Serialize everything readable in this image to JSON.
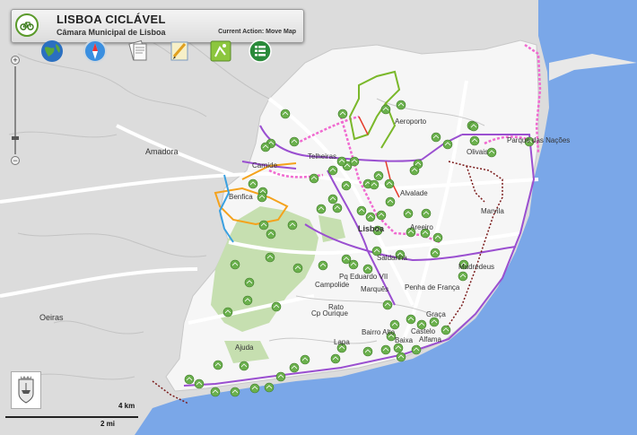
{
  "header": {
    "title": "LISBOA CICLÁVEL",
    "subtitle": "Câmara Municipal de Lisboa",
    "current_action": "Current Action: Move Map"
  },
  "toolbar": {
    "tools": [
      {
        "name": "globe-icon"
      },
      {
        "name": "compass-icon"
      },
      {
        "name": "document-icon"
      },
      {
        "name": "edit-icon"
      },
      {
        "name": "bike-route-icon"
      },
      {
        "name": "list-icon"
      }
    ]
  },
  "zoom": {
    "plus": "+",
    "minus": "−"
  },
  "scale": {
    "km": "4 km",
    "mi": "2 mi"
  },
  "labels": {
    "amadora": "Amadora",
    "oeiras": "Oeiras",
    "aeroporto": "Aeroporto",
    "lisboa": "Lisboa",
    "telheiras": "Telheiras",
    "carnide": "Carnide",
    "benfica": "Benfica",
    "alvalade": "Alvalade",
    "olivais": "Olivais",
    "parque_nacoes": "Parque das Nações",
    "marvila": "Marvila",
    "areeiro": "Areeiro",
    "saldanha": "Saldanha",
    "campolide": "Campolide",
    "pq_eduardo": "Pq Eduardo VII",
    "penha_franca": "Penha de França",
    "marques": "Marquês",
    "campo_ourique": "Cp Ourique",
    "rato": "Rato",
    "graca": "Graça",
    "bairro_alto": "Bairro Alto",
    "castelo": "Castelo",
    "alfama": "Alfama",
    "lapa": "Lapa",
    "ajuda": "Ajuda",
    "madredeus": "Madredeus",
    "baixa": "Baixa"
  },
  "colors": {
    "river": "#7aa7e8",
    "land": "#dedede",
    "city": "#f6f6f6",
    "park": "#c6dfb0",
    "route_purple": "#9a4fd0",
    "route_pink": "#f06ad0",
    "route_green": "#7ab82a",
    "route_orange": "#f4a21c",
    "route_blue": "#3aa0e0",
    "route_darkred": "#7a1a1a",
    "marker": "#6ab04c"
  }
}
